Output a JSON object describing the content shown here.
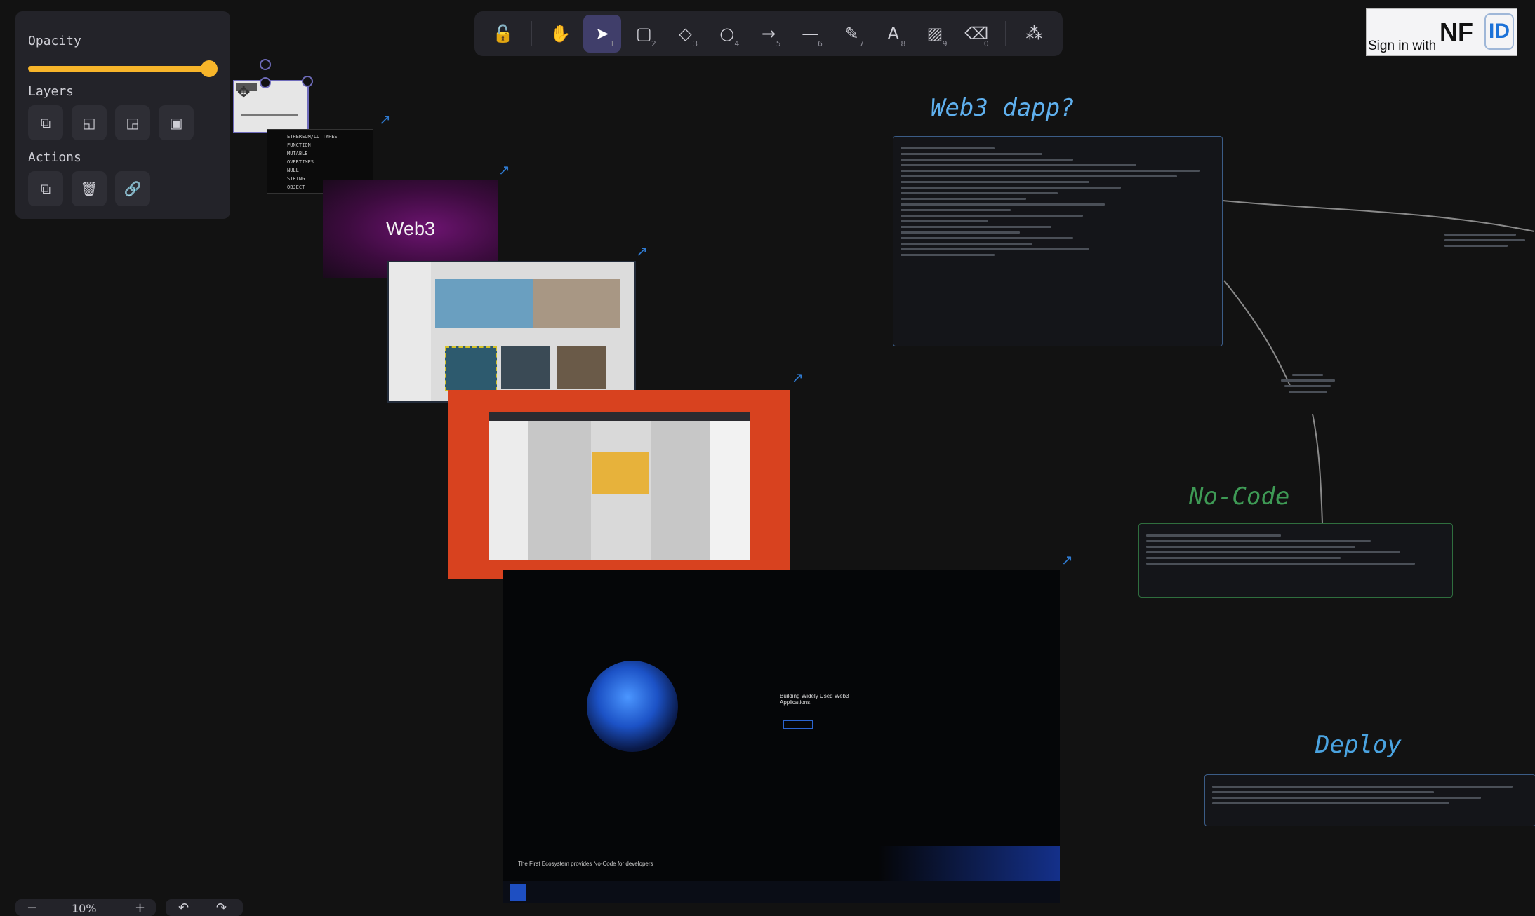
{
  "toolbar": {
    "tools": [
      {
        "name": "lock-icon",
        "glyph": "🔓",
        "key": ""
      },
      {
        "name": "hand-icon",
        "glyph": "✋",
        "key": ""
      },
      {
        "name": "select-icon",
        "glyph": "➤",
        "key": "1"
      },
      {
        "name": "rectangle-icon",
        "glyph": "▢",
        "key": "2"
      },
      {
        "name": "diamond-icon",
        "glyph": "◇",
        "key": "3"
      },
      {
        "name": "ellipse-icon",
        "glyph": "○",
        "key": "4"
      },
      {
        "name": "arrow-icon",
        "glyph": "→",
        "key": "5"
      },
      {
        "name": "line-icon",
        "glyph": "—",
        "key": "6"
      },
      {
        "name": "pencil-icon",
        "glyph": "✎",
        "key": "7"
      },
      {
        "name": "text-icon",
        "glyph": "A",
        "key": "8"
      },
      {
        "name": "image-icon",
        "glyph": "🖼",
        "key": "9"
      },
      {
        "name": "eraser-icon",
        "glyph": "⌫",
        "key": "0"
      },
      {
        "name": "shapes-library-icon",
        "glyph": "⁂",
        "key": ""
      }
    ]
  },
  "panel": {
    "opacity_label": "Opacity",
    "opacity_value": 1.0,
    "layers_label": "Layers",
    "actions_label": "Actions"
  },
  "signin": {
    "text": "Sign in with",
    "brand": "NF",
    "brand_id": "ID"
  },
  "canvas": {
    "web3_card": "Web3",
    "heading_dapp": "Web3 dapp?",
    "heading_nocode": "No-Code",
    "heading_deploy": "Deploy",
    "mini_list": [
      "ETHEREUM/LU TYPES",
      "FUNCTION",
      "MUTABLE",
      "OVERTIMES",
      "NULL",
      "STRING",
      "OBJECT"
    ],
    "hero_title": "Building Widely Used Web3 Applications.",
    "hero_footer": "The First Ecosystem provides No-Code for developers",
    "colors": {
      "background": "#121212",
      "accent": "#f7b52a",
      "dapp_heading": "#5fb0ee",
      "nocode_heading": "#3e9a55",
      "deploy_heading": "#4aa3e0",
      "orange_frame": "#d8421f",
      "web3_purple": "#5a0f59"
    }
  },
  "status": {
    "zoom": "10%"
  }
}
